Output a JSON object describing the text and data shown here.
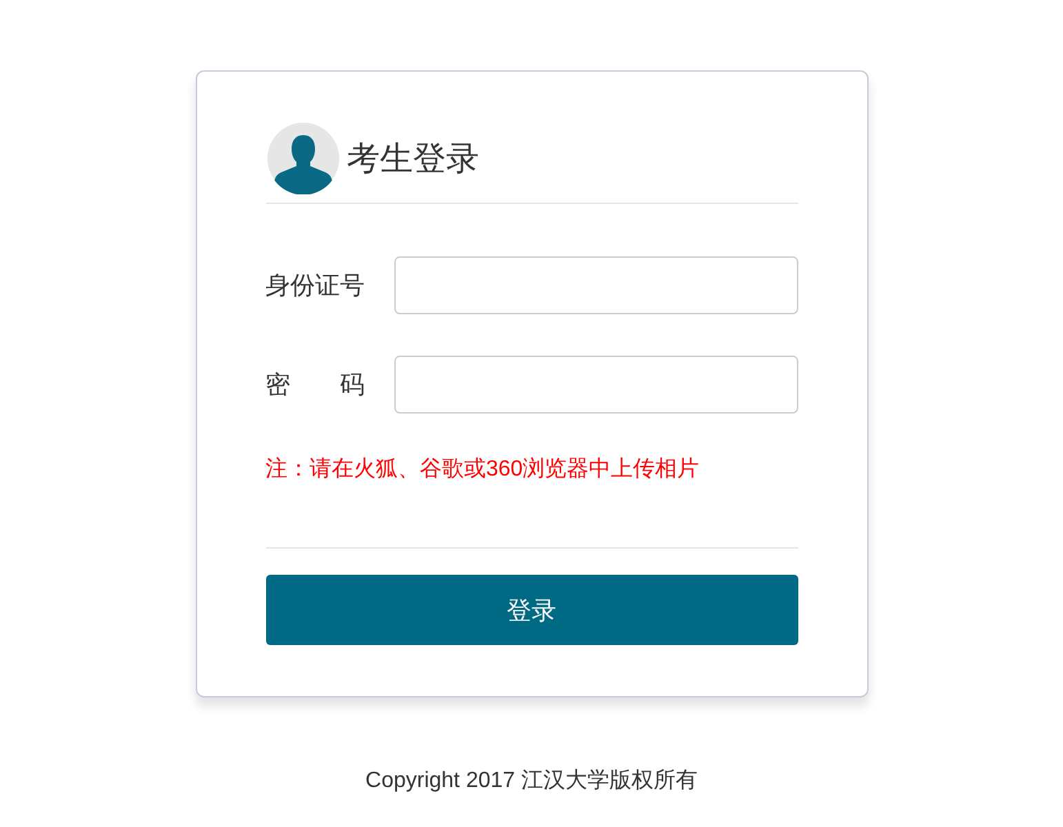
{
  "login_card": {
    "title": "考生登录",
    "fields": [
      {
        "label": "身份证号"
      },
      {
        "label": "密　　码"
      }
    ],
    "notice": "注：请在火狐、谷歌或360浏览器中上传相片",
    "submit_button": "登录"
  },
  "footer": "Copyright 2017 江汉大学版权所有"
}
